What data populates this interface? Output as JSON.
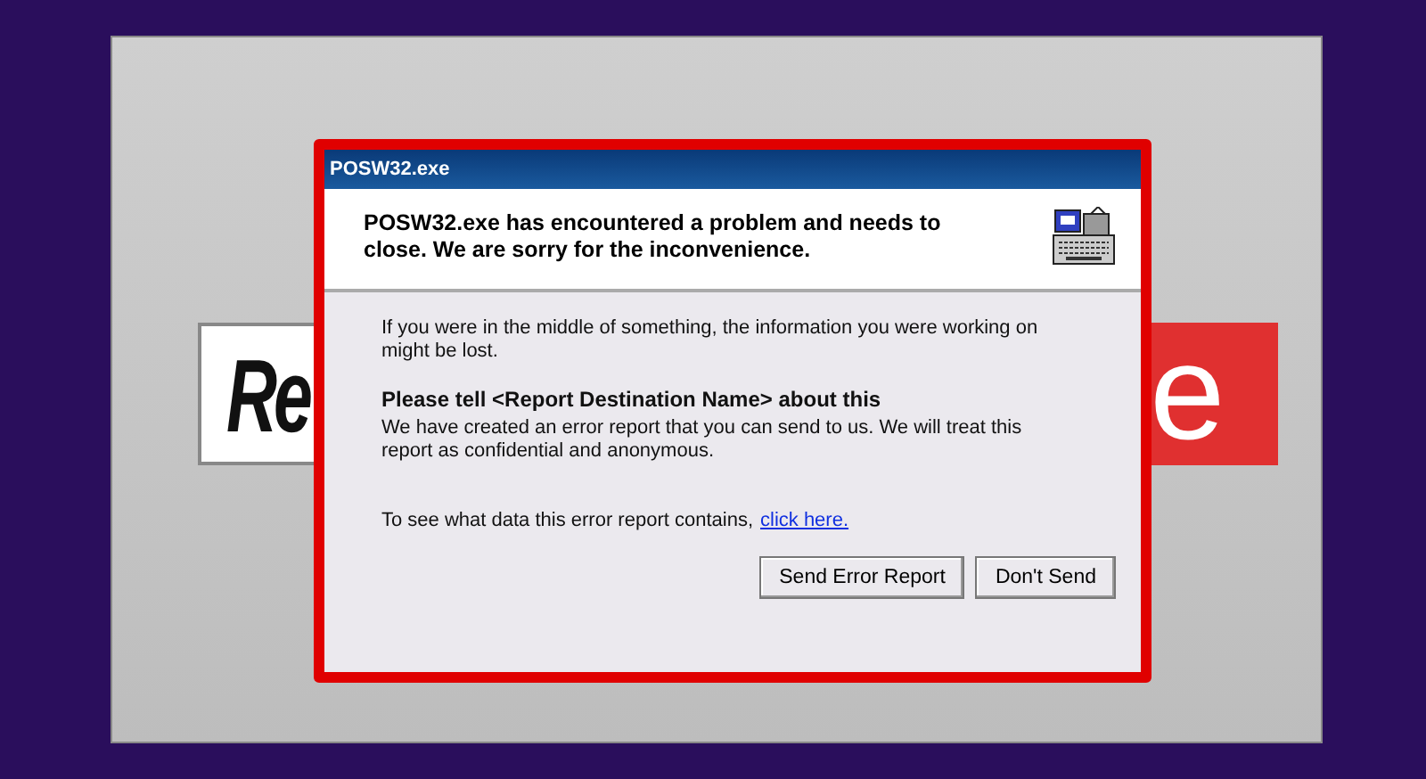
{
  "banner": {
    "left_text": "Re",
    "right_text": "e"
  },
  "dialog": {
    "title": "POSW32.exe",
    "header_message": "POSW32.exe has encountered a problem and needs to close.  We are sorry for the inconvenience.",
    "info_text": "If you were in the middle of something, the information you were working on might be lost.",
    "report_heading": "Please tell <Report Destination Name> about this",
    "report_text": "We have created an error report that you can send to us.  We will treat this report as confidential and anonymous.",
    "details_prompt": "To see what data this error report contains,",
    "details_link": "click here.",
    "buttons": [
      "Send Error Report",
      "Don't Send"
    ]
  }
}
